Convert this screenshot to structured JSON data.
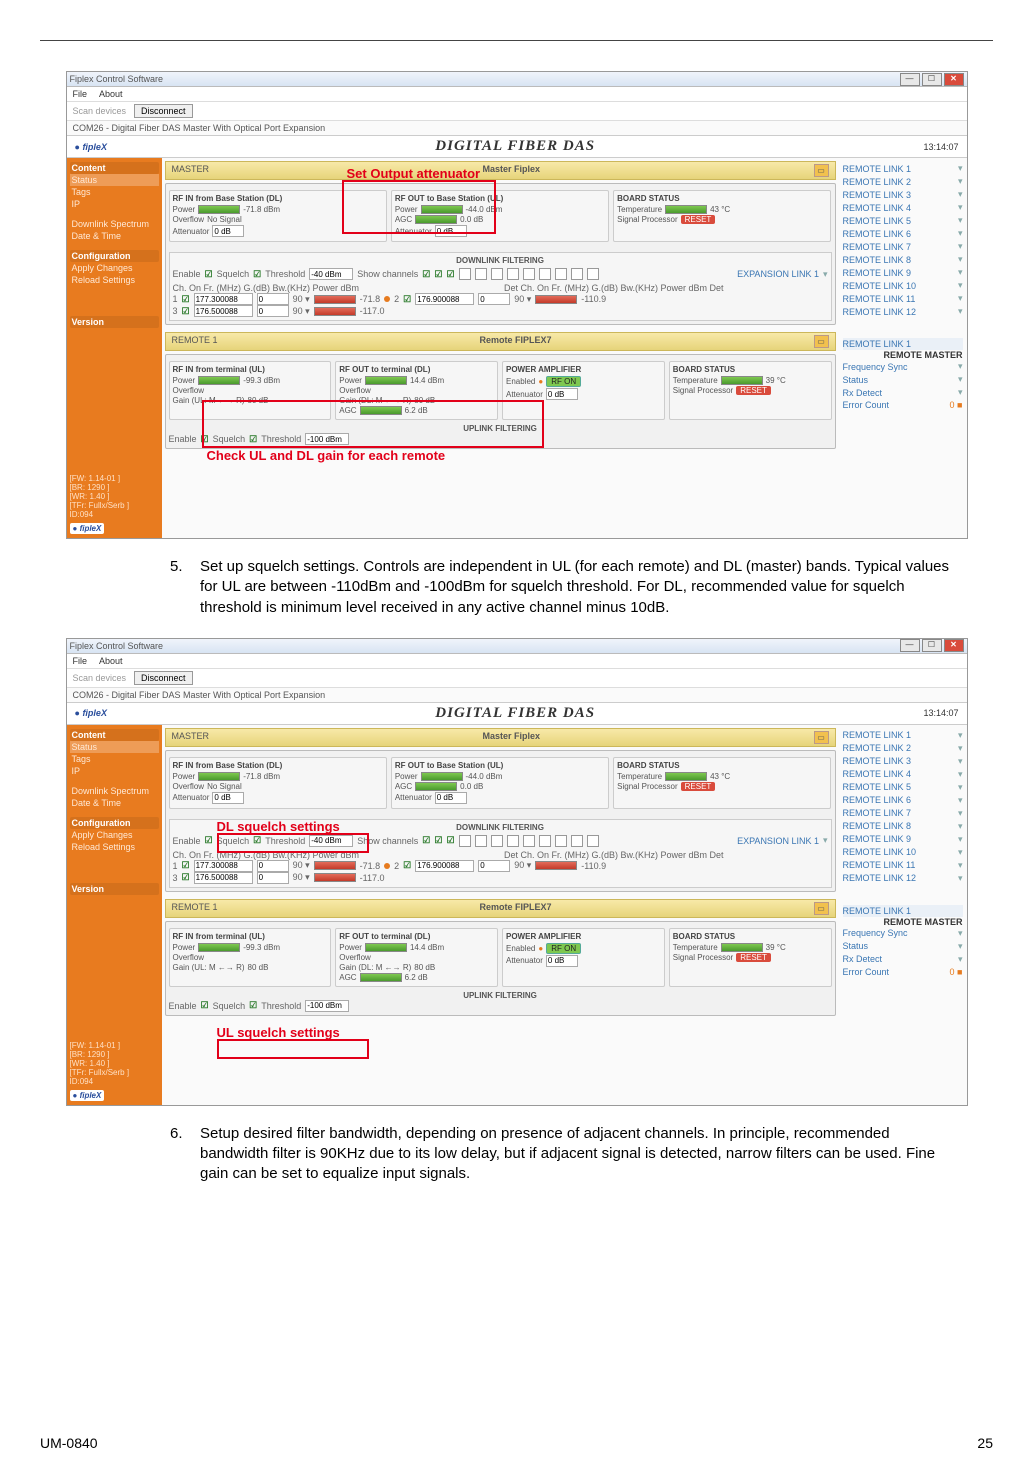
{
  "doc": {
    "footer_left": "UM-0840",
    "footer_right": "25",
    "step5_num": "5.",
    "step5_text": "Set up squelch settings. Controls are independent in UL (for each remote) and DL (master) bands. Typical values for UL are between -110dBm and -100dBm for squelch threshold. For DL, recommended value for squelch threshold is minimum level received in any active channel minus 10dB.",
    "step6_num": "6.",
    "step6_text": "Setup desired filter bandwidth, depending on presence of adjacent channels. In principle, recommended bandwidth filter is 90KHz due to its low delay, but if adjacent signal is detected, narrow filters can be used. Fine gain can be set to equalize input signals."
  },
  "annotations": {
    "set_output_att": "Set Output attenuator",
    "check_gain": "Check UL and DL gain for each remote",
    "dl_squelch": "DL squelch settings",
    "ul_squelch": "UL squelch settings"
  },
  "app": {
    "window_title": "Fiplex Control Software",
    "menu_file": "File",
    "menu_about": "About",
    "scan_label": "Scan devices",
    "disconnect_btn": "Disconnect",
    "com_desc": "COM26 - Digital Fiber DAS Master With Optical Port Expansion",
    "logo": "fipleX",
    "banner": "DIGITAL FIBER DAS",
    "clock": "13:14:07",
    "sidebar": {
      "content": "Content",
      "status": "Status",
      "tags": "Tags",
      "ip": "IP",
      "spectrum": "Downlink Spectrum",
      "date": "Date & Time",
      "config": "Configuration",
      "apply": "Apply Changes",
      "reload": "Reload Settings",
      "version": "Version",
      "ver_ln1": "[FW: 1.14-01 ]",
      "ver_ln2": "[BR:  1290 ]",
      "ver_ln3": "[WR:  1.40 ]",
      "ver_ln4": "[TFr: Fullx/Serb ]",
      "ver_ln5": "ID:094"
    },
    "master_section": "MASTER",
    "master_label": "Master Fiplex",
    "remote_section": "REMOTE 1",
    "remote_label": "Remote FIPLEX7",
    "expansion_link": "EXPANSION LINK 1",
    "remote_links": [
      "REMOTE LINK 1",
      "REMOTE LINK 2",
      "REMOTE LINK 3",
      "REMOTE LINK 4",
      "REMOTE LINK 5",
      "REMOTE LINK 6",
      "REMOTE LINK 7",
      "REMOTE LINK 8",
      "REMOTE LINK 9",
      "REMOTE LINK 10",
      "REMOTE LINK 11",
      "REMOTE LINK 12"
    ],
    "remote_link1": "REMOTE LINK 1",
    "remote_master": "REMOTE MASTER",
    "freq_sync": "Frequency Sync",
    "status_lbl": "Status",
    "rx_detect": "Rx Detect",
    "error_count": "Error Count",
    "panels": {
      "rf_in_dl": {
        "title": "RF IN from Base Station (DL)",
        "power": "Power",
        "power_val": "-71.8 dBm",
        "overflow": "Overflow",
        "overflow_val": "No Signal",
        "att": "Attenuator",
        "att_val": "0 dB"
      },
      "rf_out_ul": {
        "title": "RF OUT to Base Station (UL)",
        "power": "Power",
        "power_val": "-44.0 dBm",
        "agc": "AGC",
        "agc_val": "0.0 dB",
        "att": "Attenuator",
        "att_val": "0 dB"
      },
      "board": {
        "title": "BOARD STATUS",
        "temp": "Temperature",
        "temp_val": "43 °C",
        "sp": "Signal Processor",
        "reset": "RESET"
      },
      "dl_filt_title": "DOWNLINK FILTERING",
      "enable": "Enable",
      "squelch": "Squelch",
      "threshold": "Threshold",
      "thr_val": "-40 dBm",
      "show_ch": "Show channels",
      "ch_hdr_l": "Ch. On    Fr. (MHz)    G.(dB) Bw.(KHz) Power    dBm",
      "ch_hdr_r": "Det Ch. On    Fr. (MHz)    G.(dB) Bw.(KHz) Power    dBm Det",
      "ch1_f": "177.300088",
      "ch1_g": "0",
      "ch1_bw": "90 ▾",
      "ch1_p": "-71.8",
      "ch2_f": "176.900088",
      "ch2_g": "0",
      "ch2_bw": "90 ▾",
      "ch2_p": "-110.9",
      "ch3_f": "176.500088",
      "ch3_g": "0",
      "ch3_bw": "90 ▾",
      "ch3_p": "-117.0",
      "rf_in_ul": {
        "title": "RF IN from terminal (UL)",
        "power": "Power",
        "power_val": "-99.3 dBm",
        "overflow": "Overflow",
        "gain": "Gain (UL: M ←→ R)",
        "gain_val": "80 dB"
      },
      "rf_out_dl": {
        "title": "RF OUT to terminal (DL)",
        "power": "Power",
        "power_val": "14.4 dBm",
        "overflow": "Overflow",
        "gain": "Gain (DL: M ←→ R)",
        "gain_val": "80 dB",
        "agc": "AGC",
        "agc_val": "6.2 dB"
      },
      "pa": {
        "title": "POWER AMPLIFIER",
        "enabled": "Enabled",
        "rfon": "RF ON",
        "att": "Attenuator",
        "att_val": "0 dB"
      },
      "board_r": {
        "title": "BOARD STATUS",
        "temp": "Temperature",
        "temp_val": "39 °C",
        "sp": "Signal Processor",
        "reset": "RESET"
      },
      "ul_filt_title": "UPLINK FILTERING",
      "ul_thr": "-100 dBm"
    }
  },
  "chart_data": {
    "type": "table"
  }
}
